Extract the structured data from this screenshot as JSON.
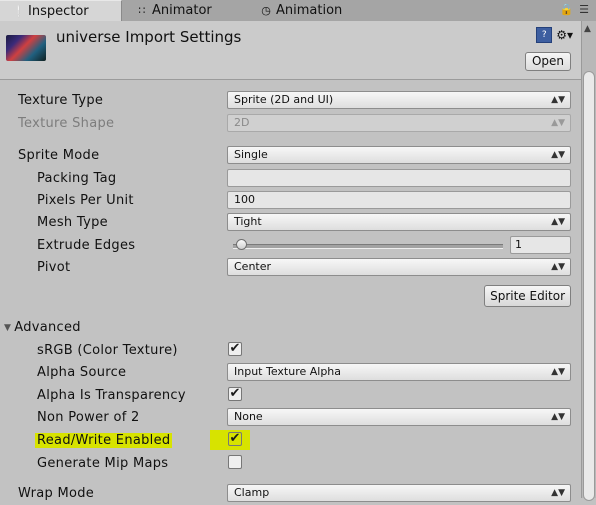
{
  "tabs": [
    {
      "label": "Inspector",
      "icon": "info-icon"
    },
    {
      "label": "Animator",
      "icon": "animator-icon"
    },
    {
      "label": "Animation",
      "icon": "clock-icon"
    }
  ],
  "header": {
    "title": "universe Import Settings",
    "open_label": "Open"
  },
  "fields": {
    "texture_type": {
      "label": "Texture Type",
      "value": "Sprite (2D and UI)"
    },
    "texture_shape": {
      "label": "Texture Shape",
      "value": "2D"
    },
    "sprite_mode": {
      "label": "Sprite Mode",
      "value": "Single"
    },
    "packing_tag": {
      "label": "Packing Tag",
      "value": ""
    },
    "pixels_per_unit": {
      "label": "Pixels Per Unit",
      "value": "100"
    },
    "mesh_type": {
      "label": "Mesh Type",
      "value": "Tight"
    },
    "extrude_edges": {
      "label": "Extrude Edges",
      "value": "1",
      "slider_fraction": 0.03
    },
    "pivot": {
      "label": "Pivot",
      "value": "Center"
    },
    "sprite_editor_label": "Sprite Editor",
    "advanced_label": "Advanced",
    "srgb": {
      "label": "sRGB (Color Texture)",
      "checked": true
    },
    "alpha_source": {
      "label": "Alpha Source",
      "value": "Input Texture Alpha"
    },
    "alpha_transparency": {
      "label": "Alpha Is Transparency",
      "checked": true
    },
    "npot": {
      "label": "Non Power of 2",
      "value": "None"
    },
    "read_write": {
      "label": "Read/Write Enabled",
      "checked": true
    },
    "mipmaps": {
      "label": "Generate Mip Maps",
      "checked": false
    },
    "wrap_mode": {
      "label": "Wrap Mode",
      "value": "Clamp"
    }
  },
  "colors": {
    "highlight": "#d7e300",
    "panel": "#c2c2c2"
  }
}
